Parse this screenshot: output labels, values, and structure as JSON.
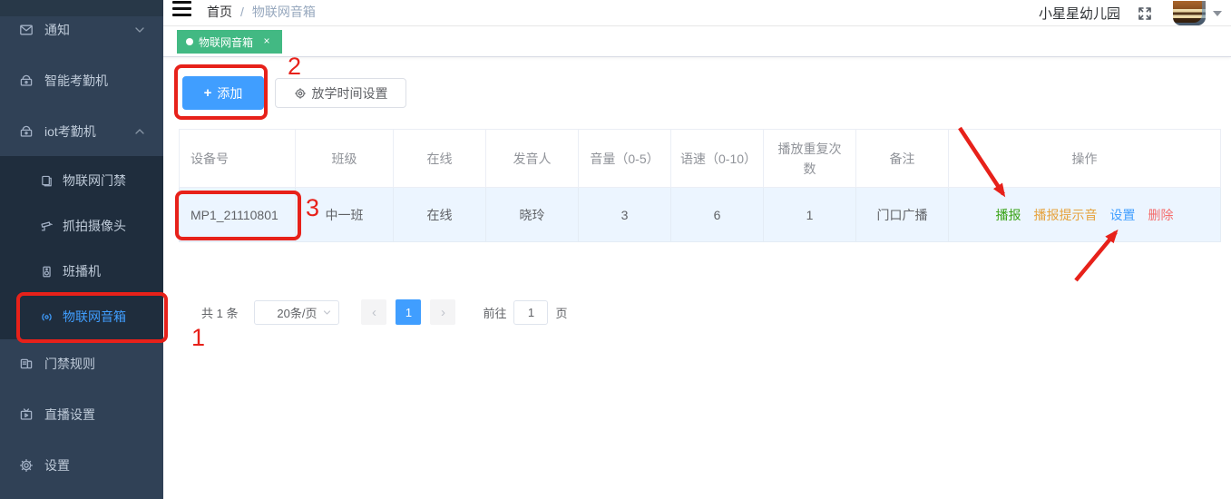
{
  "colors": {
    "accent_blue": "#409eff",
    "tag_green": "#42b983",
    "success_green": "#3aa317",
    "warning_orange": "#e6a23c",
    "danger_red": "#f56c6c",
    "annotation_red": "#e7211a",
    "sidebar_bg": "#304156",
    "submenu_bg": "#1f2d3d",
    "row_highlight": "#ecf5ff"
  },
  "navbar": {
    "breadcrumb_home": "首页",
    "breadcrumb_separator": "/",
    "breadcrumb_current": "物联网音箱",
    "school_name": "小星星幼儿园"
  },
  "tags_bar": {
    "active_tag_label": "物联网音箱",
    "close_glyph": "×"
  },
  "sidebar": {
    "items": [
      {
        "label": "通知",
        "icon": "envelope-icon",
        "arrow": "down"
      },
      {
        "label": "智能考勤机",
        "icon": "attendance-machine-icon",
        "arrow": ""
      },
      {
        "label": "iot考勤机",
        "icon": "attendance-machine-icon",
        "arrow": "up"
      }
    ],
    "submenu_items": [
      {
        "label": "物联网门禁",
        "icon": "door-access-icon",
        "active": false
      },
      {
        "label": "抓拍摄像头",
        "icon": "camera-icon",
        "active": false
      },
      {
        "label": "班播机",
        "icon": "speaker-icon",
        "active": false
      },
      {
        "label": "物联网音箱",
        "icon": "audio-waves-icon",
        "active": true
      }
    ],
    "items_bottom": [
      {
        "label": "门禁规则",
        "icon": "rules-icon"
      },
      {
        "label": "直播设置",
        "icon": "live-tv-icon"
      },
      {
        "label": "设置",
        "icon": "gear-icon"
      }
    ]
  },
  "toolbar": {
    "add_label": "添加",
    "add_plus_glyph": "+",
    "dismissal_time_label": "放学时间设置"
  },
  "table": {
    "headers": [
      "设备号",
      "班级",
      "在线",
      "发音人",
      "音量（0-5）",
      "语速（0-10）",
      "播放重复次数",
      "备注",
      "操作"
    ],
    "rows": [
      {
        "device_no": "MP1_21110801",
        "class_name": "中一班",
        "online_status": "在线",
        "voice": "晓玲",
        "volume": "3",
        "speed": "6",
        "repeat_count": "1",
        "remark": "门口广播",
        "actions": {
          "broadcast": "播报",
          "broadcast_tone": "播报提示音",
          "settings": "设置",
          "delete": "删除"
        }
      }
    ]
  },
  "pagination": {
    "total_label": "共 1 条",
    "page_size_label": "20条/页",
    "prev_glyph": "‹",
    "current_page": "1",
    "next_glyph": "›",
    "goto_label": "前往",
    "goto_value": "1",
    "page_unit": "页"
  },
  "annotations": {
    "step_1": "1",
    "step_2": "2",
    "step_3": "3"
  }
}
